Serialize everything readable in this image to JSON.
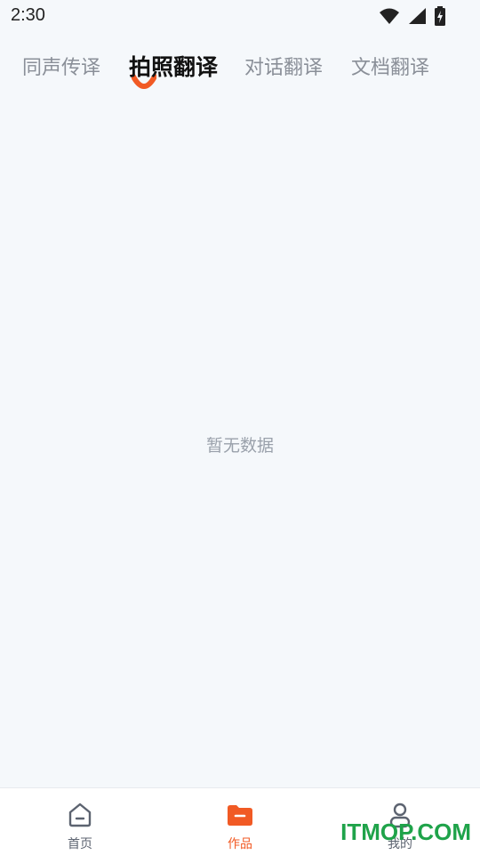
{
  "status_bar": {
    "time": "2:30",
    "icons": [
      "wifi-icon",
      "signal-icon",
      "battery-icon"
    ]
  },
  "tabs": [
    {
      "label": "同声传译",
      "active": false
    },
    {
      "label": "拍照翻译",
      "active": true
    },
    {
      "label": "对话翻译",
      "active": false
    },
    {
      "label": "文档翻译",
      "active": false
    }
  ],
  "empty_state": {
    "text": "暂无数据"
  },
  "bottom_nav": [
    {
      "label": "首页",
      "icon": "home-icon",
      "active": false
    },
    {
      "label": "作品",
      "icon": "folder-icon",
      "active": true
    },
    {
      "label": "我的",
      "icon": "user-icon",
      "active": false
    }
  ],
  "watermark": "ITMOP.COM",
  "colors": {
    "accent": "#f15a24",
    "background": "#f5f8fb",
    "inactive_text": "#8a8f98",
    "watermark": "#1fa34a"
  }
}
